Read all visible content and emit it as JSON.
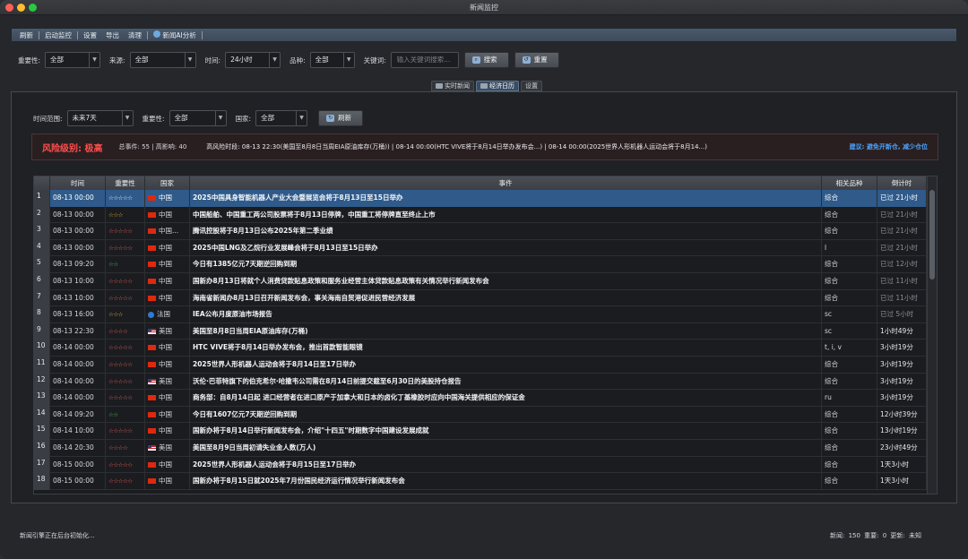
{
  "window": {
    "title": "新闻监控"
  },
  "menu": [
    "刷新",
    "启动监控",
    "设置",
    "导出",
    "清理",
    "新闻AI分析"
  ],
  "filters": {
    "importance_label": "重要性:",
    "importance_value": "全部",
    "source_label": "来源:",
    "source_value": "全部",
    "time_label": "时间:",
    "time_value": "24小时",
    "variety_label": "品种:",
    "variety_value": "全部",
    "keyword_label": "关键词:",
    "keyword_placeholder": "输入关键词搜索...",
    "search_label": "搜索",
    "reset_label": "重置"
  },
  "tabs": [
    "实时新闻",
    "经济日历",
    "设置"
  ],
  "calendar_filters": {
    "range_label": "时间范围:",
    "range_value": "未来7天",
    "importance_label": "重要性:",
    "importance_value": "全部",
    "country_label": "国家:",
    "country_value": "全部",
    "refresh_label": "刷新"
  },
  "risk": {
    "level": "风险级别: 极高",
    "stats": "总事件: 55 | 高影响: 40",
    "high_risk": "高风险时段: 08-13 22:30(美国至8月8日当周EIA原油库存(万桶)) | 08-14 00:00(HTC VIVE将于8月14日举办发布会...) | 08-14 00:00(2025世界人形机器人运动会将于8月14...)",
    "advice": "建议: 避免开新仓, 减少仓位"
  },
  "table": {
    "columns": [
      "时间",
      "重要性",
      "国家",
      "事件",
      "相关品种",
      "倒计时"
    ],
    "rows": [
      {
        "n": "1",
        "time": "08-13 00:00",
        "stars": "☆☆☆☆☆",
        "level": 5,
        "flag": "cn",
        "country": "中国",
        "event": "2025中国具身智能机器人产业大会暨展览会将于8月13日至15日举办",
        "variety": "综合",
        "countdown": "已过 21小时",
        "past": true
      },
      {
        "n": "2",
        "time": "08-13 00:00",
        "stars": "☆☆☆",
        "level": 3,
        "flag": "cn",
        "country": "中国",
        "event": "中国船舶、中国重工两公司股票将于8月13日停牌，中国重工将停牌直至终止上市",
        "variety": "综合",
        "countdown": "已过 21小时",
        "past": true
      },
      {
        "n": "3",
        "time": "08-13 00:00",
        "stars": "☆☆☆☆☆",
        "level": 5,
        "flag": "cn",
        "country": "中国...",
        "event": "腾讯控股将于8月13日公布2025年第二季业绩",
        "variety": "综合",
        "countdown": "已过 21小时",
        "past": true
      },
      {
        "n": "4",
        "time": "08-13 00:00",
        "stars": "☆☆☆☆☆",
        "level": 5,
        "flag": "cn",
        "country": "中国",
        "event": "2025中国LNG及乙烷行业发展峰会将于8月13日至15日举办",
        "variety": "l",
        "countdown": "已过 21小时",
        "past": true
      },
      {
        "n": "5",
        "time": "08-13 09:20",
        "stars": "☆☆",
        "level": 2,
        "flag": "cn",
        "country": "中国",
        "event": "今日有1385亿元7天期逆回购到期",
        "variety": "综合",
        "countdown": "已过 12小时",
        "past": true
      },
      {
        "n": "6",
        "time": "08-13 10:00",
        "stars": "☆☆☆☆☆",
        "level": 5,
        "flag": "cn",
        "country": "中国",
        "event": "国新办8月13日将就个人消费贷款贴息政策和服务业经营主体贷款贴息政策有关情况举行新闻发布会",
        "variety": "综合",
        "countdown": "已过 11小时",
        "past": true
      },
      {
        "n": "7",
        "time": "08-13 10:00",
        "stars": "☆☆☆☆☆",
        "level": 5,
        "flag": "cn",
        "country": "中国",
        "event": "海南省新闻办8月13日召开新闻发布会，事关海南自贸港促进民营经济发展",
        "variety": "综合",
        "countdown": "已过 11小时",
        "past": true
      },
      {
        "n": "8",
        "time": "08-13 16:00",
        "stars": "☆☆☆",
        "level": 3,
        "flag": "fr",
        "country": "法国",
        "event": "IEA公布月度原油市场报告",
        "variety": "sc",
        "countdown": "已过 5小时",
        "past": true
      },
      {
        "n": "9",
        "time": "08-13 22:30",
        "stars": "☆☆☆☆",
        "level": 4,
        "flag": "us",
        "country": "美国",
        "event": "美国至8月8日当周EIA原油库存(万桶)",
        "variety": "sc",
        "countdown": "1小时49分",
        "past": false
      },
      {
        "n": "10",
        "time": "08-14 00:00",
        "stars": "☆☆☆☆☆",
        "level": 5,
        "flag": "cn",
        "country": "中国",
        "event": "HTC VIVE将于8月14日举办发布会，推出首款智能眼镜",
        "variety": "t, i, v",
        "countdown": "3小时19分",
        "past": false
      },
      {
        "n": "11",
        "time": "08-14 00:00",
        "stars": "☆☆☆☆☆",
        "level": 5,
        "flag": "cn",
        "country": "中国",
        "event": "2025世界人形机器人运动会将于8月14日至17日举办",
        "variety": "综合",
        "countdown": "3小时19分",
        "past": false
      },
      {
        "n": "12",
        "time": "08-14 00:00",
        "stars": "☆☆☆☆☆",
        "level": 5,
        "flag": "us",
        "country": "美国",
        "event": "沃伦·巴菲特旗下的伯克希尔·哈撒韦公司需在8月14日前提交截至6月30日的美股持仓报告",
        "variety": "综合",
        "countdown": "3小时19分",
        "past": false
      },
      {
        "n": "13",
        "time": "08-14 00:00",
        "stars": "☆☆☆☆☆",
        "level": 5,
        "flag": "cn",
        "country": "中国",
        "event": "商务部：自8月14日起 进口经营者在进口原产于加拿大和日本的卤化丁基橡胶时应向中国海关提供相应的保证金",
        "variety": "ru",
        "countdown": "3小时19分",
        "past": false
      },
      {
        "n": "14",
        "time": "08-14 09:20",
        "stars": "☆☆",
        "level": 2,
        "flag": "cn",
        "country": "中国",
        "event": "今日有1607亿元7天期逆回购到期",
        "variety": "综合",
        "countdown": "12小时39分",
        "past": false
      },
      {
        "n": "15",
        "time": "08-14 10:00",
        "stars": "☆☆☆☆☆",
        "level": 5,
        "flag": "cn",
        "country": "中国",
        "event": "国新办将于8月14日举行新闻发布会，介绍\"十四五\"时期数字中国建设发展成就",
        "variety": "综合",
        "countdown": "13小时19分",
        "past": false
      },
      {
        "n": "16",
        "time": "08-14 20:30",
        "stars": "☆☆☆☆",
        "level": 4,
        "flag": "us",
        "country": "美国",
        "event": "美国至8月9日当周初请失业金人数(万人)",
        "variety": "综合",
        "countdown": "23小时49分",
        "past": false
      },
      {
        "n": "17",
        "time": "08-15 00:00",
        "stars": "☆☆☆☆☆",
        "level": 5,
        "flag": "cn",
        "country": "中国",
        "event": "2025世界人形机器人运动会将于8月15日至17日举办",
        "variety": "综合",
        "countdown": "1天3小时",
        "past": false
      },
      {
        "n": "18",
        "time": "08-15 00:00",
        "stars": "☆☆☆☆☆",
        "level": 5,
        "flag": "cn",
        "country": "中国",
        "event": "国新办将于8月15日就2025年7月份国民经济运行情况举行新闻发布会",
        "variety": "综合",
        "countdown": "1天3小时",
        "past": false
      }
    ]
  },
  "status": {
    "left": "新闻引擎正在后台初始化...",
    "right": "新闻: 150   重要: 0   更新: 未知"
  }
}
